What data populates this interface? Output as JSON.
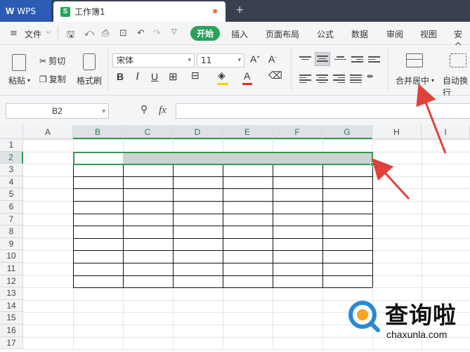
{
  "titlebar": {
    "app_name": "WPS",
    "doc_title": "工作簿1",
    "doc_icon": "S"
  },
  "menu": {
    "file": "文件",
    "start": "开始",
    "items": [
      "插入",
      "页面布局",
      "公式",
      "数据",
      "审阅",
      "视图",
      "安全"
    ]
  },
  "ribbon": {
    "paste": "粘贴",
    "cut": "剪切",
    "copy": "复制",
    "format_painter": "格式刷",
    "font_name": "宋体",
    "font_size": "11",
    "merge_center": "合并居中",
    "auto_wrap": "自动换行"
  },
  "formula_bar": {
    "cell_ref": "B2",
    "fx": "fx",
    "value": ""
  },
  "sheet": {
    "columns": [
      "A",
      "B",
      "C",
      "D",
      "E",
      "F",
      "G",
      "H",
      "I"
    ],
    "rows": [
      "1",
      "2",
      "3",
      "4",
      "5",
      "6",
      "7",
      "8",
      "9",
      "10",
      "11",
      "12",
      "13",
      "14",
      "15",
      "16",
      "17"
    ],
    "selected_cell": "B2"
  },
  "watermark": {
    "cn": "查询啦",
    "domain": "chaxunla.com"
  },
  "colors": {
    "accent": "#27a35a",
    "titlebar": "#39404f",
    "wps_tab": "#2c5bb5",
    "arrow": "#e0413a"
  }
}
